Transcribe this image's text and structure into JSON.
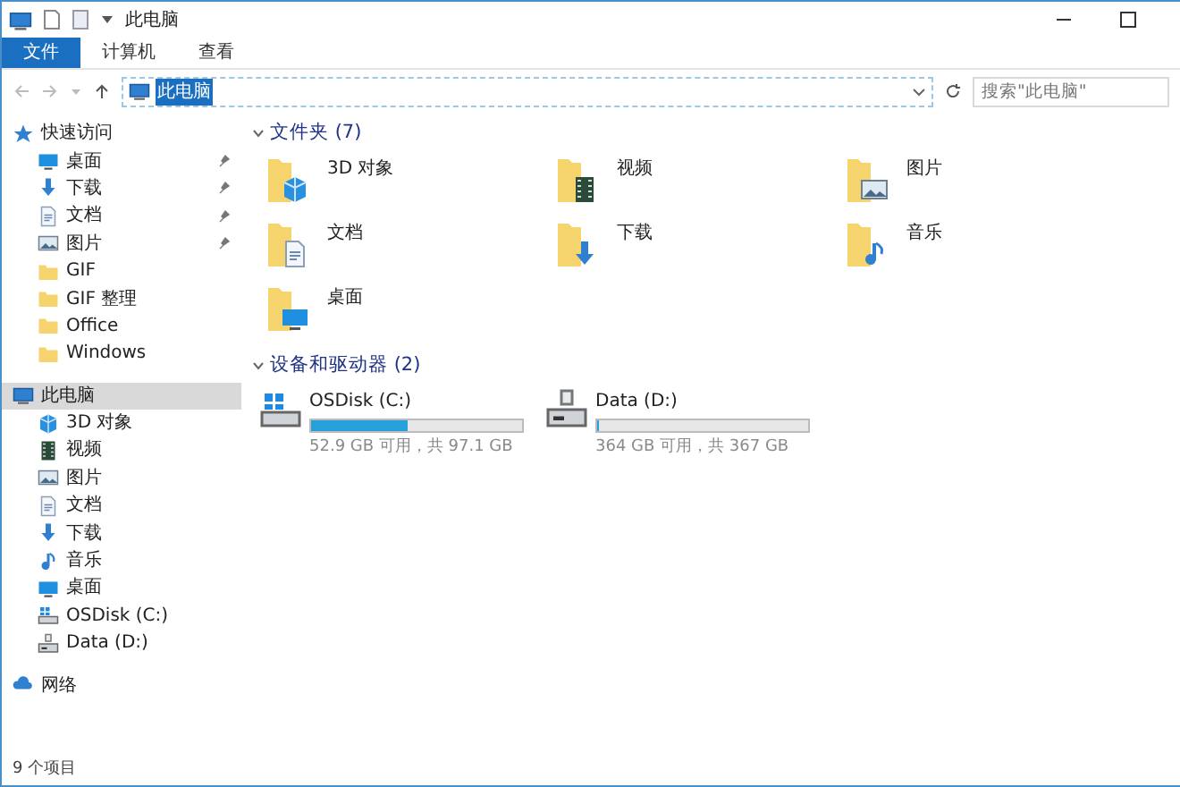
{
  "window": {
    "title": "此电脑"
  },
  "ribbon_tabs": [
    {
      "label": "文件",
      "selected": true
    },
    {
      "label": "计算机",
      "selected": false
    },
    {
      "label": "查看",
      "selected": false
    }
  ],
  "address": {
    "value": "此电脑"
  },
  "search": {
    "placeholder": "搜索\"此电脑\""
  },
  "sidebar": [
    {
      "label": "快速访问",
      "kind": "star",
      "selected": false,
      "children": [
        {
          "label": "桌面",
          "kind": "desktop",
          "selected": false,
          "pinned": true
        },
        {
          "label": "下载",
          "kind": "download",
          "selected": false,
          "pinned": true
        },
        {
          "label": "文档",
          "kind": "documents",
          "selected": false,
          "pinned": true
        },
        {
          "label": "图片",
          "kind": "pictures",
          "selected": false,
          "pinned": true
        },
        {
          "label": "GIF",
          "kind": "folder",
          "selected": false,
          "pinned": false
        },
        {
          "label": "GIF 整理",
          "kind": "folder",
          "selected": false,
          "pinned": false
        },
        {
          "label": "Office",
          "kind": "folder",
          "selected": false,
          "pinned": false
        },
        {
          "label": "Windows",
          "kind": "folder",
          "selected": false,
          "pinned": false
        }
      ]
    },
    {
      "label": "此电脑",
      "kind": "pc",
      "selected": true,
      "children": [
        {
          "label": "3D 对象",
          "kind": "objects",
          "selected": false
        },
        {
          "label": "视频",
          "kind": "video",
          "selected": false
        },
        {
          "label": "图片",
          "kind": "pictures",
          "selected": false
        },
        {
          "label": "文档",
          "kind": "documents",
          "selected": false
        },
        {
          "label": "下载",
          "kind": "download",
          "selected": false
        },
        {
          "label": "音乐",
          "kind": "music",
          "selected": false
        },
        {
          "label": "桌面",
          "kind": "desktop",
          "selected": false
        },
        {
          "label": "OSDisk (C:)",
          "kind": "systemdrive",
          "selected": false
        },
        {
          "label": "Data (D:)",
          "kind": "datadrive",
          "selected": false
        }
      ]
    },
    {
      "label": "网络",
      "kind": "network",
      "selected": false
    }
  ],
  "folders_group": {
    "heading": "文件夹 (7)",
    "items": [
      {
        "label": "3D 对象",
        "kind": "objects"
      },
      {
        "label": "视频",
        "kind": "video"
      },
      {
        "label": "图片",
        "kind": "pictures"
      },
      {
        "label": "文档",
        "kind": "documents"
      },
      {
        "label": "下载",
        "kind": "download"
      },
      {
        "label": "音乐",
        "kind": "music"
      },
      {
        "label": "桌面",
        "kind": "desktop"
      }
    ]
  },
  "drives_group": {
    "heading": "设备和驱动器 (2)",
    "items": [
      {
        "label": "OSDisk (C:)",
        "kind": "systemdrive",
        "level": 0.46,
        "free": "52.9 GB 可用，共 97.1 GB"
      },
      {
        "label": "Data (D:)",
        "kind": "datadrive",
        "level": 0.01,
        "free": "364 GB 可用，共 367 GB"
      }
    ]
  },
  "status_bar": {
    "count": "9 个项目"
  }
}
